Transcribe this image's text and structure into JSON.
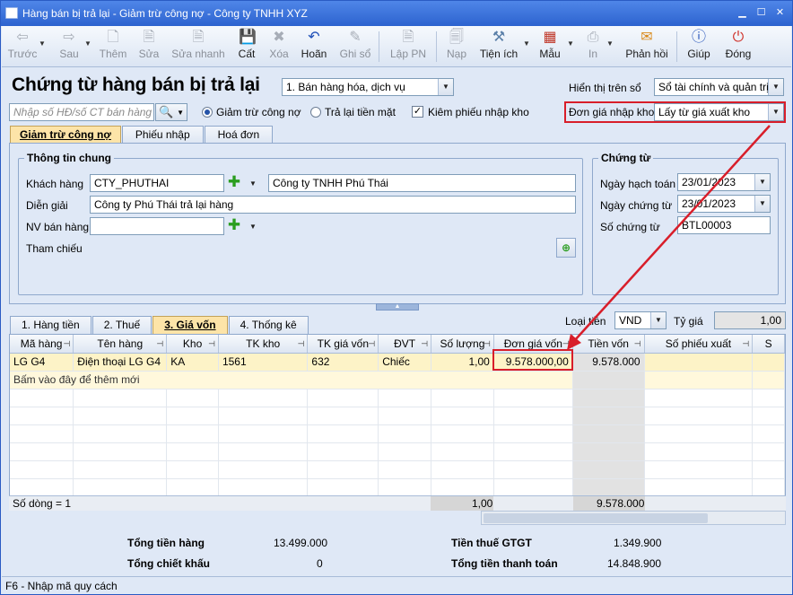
{
  "window": {
    "title": "Hàng bán bị trả lại - Giảm trừ công nợ - Công ty TNHH XYZ"
  },
  "toolbar": {
    "prev": "Trước",
    "next": "Sau",
    "add": "Thêm",
    "edit": "Sửa",
    "quick_edit": "Sửa nhanh",
    "save": "Cất",
    "delete": "Xóa",
    "undo": "Hoãn",
    "post": "Ghi sổ",
    "create_pn": "Lập PN",
    "load": "Nạp",
    "utilities": "Tiện ích",
    "template": "Mẫu",
    "print": "In",
    "feedback": "Phản hồi",
    "help": "Giúp",
    "close": "Đóng"
  },
  "header": {
    "title": "Chứng từ hàng bán bị trả lại",
    "type_select": "1. Bán hàng hóa, dịch vụ",
    "display_label": "Hiển thị trên sổ",
    "display_value": "Sổ tài chính và quản trị",
    "search_placeholder": "Nhập số HĐ/số CT bán hàng",
    "radio_reduce_debt": "Giảm trừ công nợ",
    "radio_refund": "Trả lại tiền mặt",
    "check_receipt": "Kiêm phiếu nhập kho",
    "unit_price_label": "Đơn giá nhập kho",
    "unit_price_value": "Lấy từ giá xuất kho"
  },
  "tabs": {
    "t1": "Giảm trừ công nợ",
    "t2": "Phiếu nhập",
    "t3": "Hoá đơn"
  },
  "general": {
    "group_title": "Thông tin chung",
    "customer_label": "Khách hàng",
    "customer_code": "CTY_PHUTHAI",
    "customer_name": "Công ty TNHH Phú Thái",
    "desc_label": "Diễn giải",
    "desc_value": "Công ty Phú Thái trả lại hàng",
    "staff_label": "NV bán hàng",
    "ref_label": "Tham chiếu"
  },
  "voucher": {
    "group_title": "Chứng từ",
    "posting_date_label": "Ngày hạch toán",
    "posting_date": "23/01/2023",
    "voucher_date_label": "Ngày chứng từ",
    "voucher_date": "23/01/2023",
    "voucher_no_label": "Số chứng từ",
    "voucher_no": "BTL00003"
  },
  "detail_tabs": {
    "d1": "1. Hàng tiền",
    "d2": "2. Thuế",
    "d3": "3. Giá vốn",
    "d4": "4. Thống kê"
  },
  "currency": {
    "label": "Loại tiền",
    "value": "VND",
    "rate_label": "Tỷ giá",
    "rate_value": "1,00"
  },
  "grid": {
    "headers": [
      "Mã hàng",
      "Tên hàng",
      "Kho",
      "TK kho",
      "TK giá vốn",
      "ĐVT",
      "Số lượng",
      "Đơn giá vốn",
      "Tiền vốn",
      "Số phiếu xuất",
      "S"
    ],
    "rows": [
      [
        "LG G4",
        "Điện thoại LG G4",
        "KA",
        "1561",
        "632",
        "Chiếc",
        "1,00",
        "9.578.000,00",
        "9.578.000",
        "",
        ""
      ]
    ],
    "add_hint": "Bấm vào đây để thêm mới",
    "footer_count": "Số dòng = 1",
    "footer_qty": "1,00",
    "footer_cost": "9.578.000"
  },
  "totals": {
    "goods_label": "Tổng tiền hàng",
    "goods_value": "13.499.000",
    "discount_label": "Tổng chiết khấu",
    "discount_value": "0",
    "vat_label": "Tiền thuế GTGT",
    "vat_value": "1.349.900",
    "payment_label": "Tổng tiền thanh toán",
    "payment_value": "14.848.900"
  },
  "status": {
    "text": "F6 - Nhập mã quy cách"
  },
  "colors": {
    "highlight": "#d81e2a",
    "active_tab": "#fde4a8",
    "row": "#fdf3c7"
  }
}
